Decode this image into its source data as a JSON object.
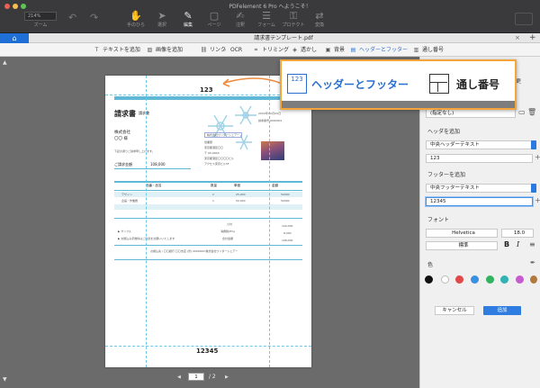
{
  "app_title": "PDFelement 6 Pro へようこそ！",
  "toolbar": {
    "zoom_value": "214%",
    "zoom_label": "ズーム",
    "items": [
      {
        "label": "手のひら",
        "icon": "hand-icon"
      },
      {
        "label": "選択",
        "icon": "cursor-icon"
      },
      {
        "label": "編集",
        "icon": "edit-icon"
      },
      {
        "label": "ページ",
        "icon": "pages-icon"
      },
      {
        "label": "注釈",
        "icon": "comment-icon"
      },
      {
        "label": "フォーム",
        "icon": "form-icon"
      },
      {
        "label": "プロテクト",
        "icon": "lock-icon"
      },
      {
        "label": "変換",
        "icon": "convert-icon"
      }
    ]
  },
  "tab": {
    "title": "請求書テンプレート.pdf",
    "close": "×",
    "add": "+"
  },
  "edit_toolbar": [
    {
      "label": "テキストを追加",
      "icon": "text-icon"
    },
    {
      "label": "画像を追加",
      "icon": "image-icon"
    },
    {
      "label": "リンク",
      "icon": "link-icon"
    },
    {
      "label": "OCR",
      "icon": "ocr-icon"
    },
    {
      "label": "トリミング",
      "icon": "crop-icon"
    },
    {
      "label": "透かし",
      "icon": "watermark-icon"
    },
    {
      "label": "背景",
      "icon": "background-icon"
    },
    {
      "label": "ヘッダーとフッター",
      "icon": "header-footer-icon"
    },
    {
      "label": "通し番号",
      "icon": "bates-icon"
    }
  ],
  "callout": {
    "header_footer": "ヘッダーとフッター",
    "header_footer_icon": "123",
    "bates": "通し番号"
  },
  "pdf": {
    "header_number": "123",
    "footer_number": "12345",
    "invoice_title": "請求書",
    "invoice_sub": "請求書",
    "company_to": "株式会社",
    "company_to2": "〇〇 様",
    "greeting": "下記の通りご請求申し上げます。",
    "amount_label": "ご請求金額",
    "amount_value": "108,000",
    "issuer": "株式会社ワンダーシェアー",
    "issuer_dept": "営業部",
    "issuer_addr1": "東京都港区〇〇",
    "issuer_addr2": "〒 00-0000",
    "issuer_addr3": "東京都港区〇〇〇〇ビル",
    "issuer_addr4": "アクセス東京ビル5F",
    "date_label": "20XX年XX月XX日",
    "no_label": "請求番号 0000001",
    "table_head": [
      "品番・品名",
      "数量",
      "単価",
      "金額"
    ],
    "rows": [
      [
        "デザイン",
        "2",
        "25,000",
        "50000"
      ],
      [
        "企画・作業費",
        "1",
        "50,000",
        "50000"
      ]
    ],
    "subtotal_label": "小計",
    "subtotal_value": "100,000",
    "tax_label": "消費税(8%)",
    "tax_value": "8,000",
    "total_label": "合計金額",
    "total_value": "108,000",
    "note1": "▶ サンプル",
    "note2": "▶ お振込み手数料はご負担をお願いいたします",
    "bank": "お振込先 / 〇〇銀行 〇〇支店 (普) 0000000 株式会社ワンダーシェアー"
  },
  "pagenav": {
    "current": "1",
    "total": "/ 2",
    "prev": "◀",
    "next": "▶"
  },
  "panel": {
    "partial_label": "変更",
    "preset_value": "(指定なし)",
    "header_section": "ヘッダを追加",
    "header_position": "中央ヘッダーテキスト",
    "header_text": "123",
    "footer_section": "フッターを追加",
    "footer_position": "中央フッターテキスト",
    "footer_text": "12345",
    "font_section": "フォント",
    "font_name": "Helvetica",
    "font_size": "18.0",
    "font_style": "標準",
    "bold": "B",
    "italic": "I",
    "color_section": "色",
    "colors": [
      "#111111",
      "#ffffff",
      "#e24848",
      "#3a8fe0",
      "#33b360",
      "#2fb3b3",
      "#c85ad1",
      "#b0793d"
    ],
    "cancel": "キャンセル",
    "apply": "追加"
  }
}
